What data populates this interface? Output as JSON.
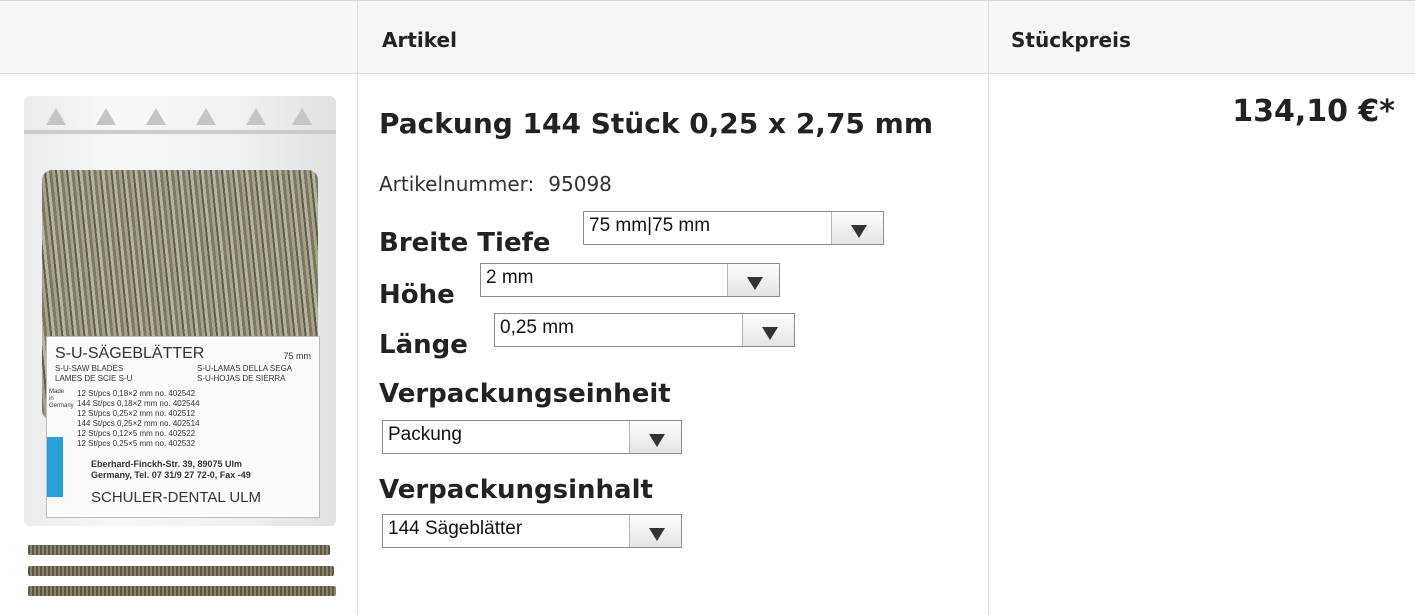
{
  "table": {
    "col_article": "Artikel",
    "col_unit_price": "Stückpreis"
  },
  "product": {
    "title": "Packung 144 Stück 0,25 x 2,75 mm",
    "artno_label": "Artikelnummer:",
    "artno_value": "95098",
    "price": "134,10 €*",
    "image": {
      "label_title": "S-U-SÄGEBLÄTTER",
      "label_size": "75 mm",
      "label_line1": "S-U-SAW BLADES",
      "label_line2": "LAMES DE SCIE S-U",
      "label_line3": "S-U-LAMAS DELLA SEGA",
      "label_line4": "S-U-HOJAS DE SIERRA",
      "made_in": "Made in Germany",
      "rows": [
        "12 St/pcs  0,18×2 mm  no. 402542",
        "144 St/pcs  0,18×2 mm  no. 402544",
        "12 St/pcs  0,25×2 mm  no. 402512",
        "144 St/pcs  0,25×2 mm  no. 402514",
        "12 St/pcs  0,12×5 mm  no. 402522",
        "12 St/pcs  0,25×5 mm  no. 402532"
      ],
      "address_line1": "Eberhard-Finckh-Str. 39, 89075 Ulm",
      "address_line2": "Germany, Tel. 07 31/9 27 72-0, Fax -49",
      "brand": "SCHULER-DENTAL ULM"
    }
  },
  "options": {
    "breite_tiefe": {
      "label": "Breite Tiefe",
      "value": "75 mm|75 mm"
    },
    "hoehe": {
      "label": "Höhe",
      "value": "2 mm"
    },
    "laenge": {
      "label": "Länge",
      "value": "0,25 mm"
    },
    "verpackungseinheit": {
      "label": "Verpackungseinheit",
      "value": "Packung"
    },
    "verpackungsinhalt": {
      "label": "Verpackungsinhalt",
      "value": "144 Sägeblätter"
    }
  }
}
